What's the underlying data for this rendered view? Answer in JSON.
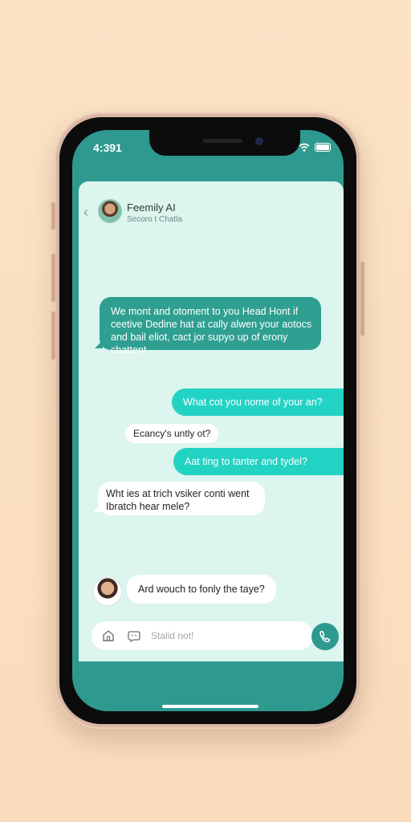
{
  "status_bar": {
    "time": "4:391"
  },
  "chat_header": {
    "back_label": "‹",
    "name": "Feemily AI",
    "subtitle": "Secoro t Chatla"
  },
  "messages": [
    {
      "text": "We mont and otoment to you Head Hont if ceetive Dedine hat at cally alwen your aotocs and bail eliot, cact jor supyo up of erony chattent"
    },
    {
      "text": "What cot you nome of your an?"
    },
    {
      "text": "Ecancy's untly ot?"
    },
    {
      "text": "Aat ting to tanter and tydel?"
    },
    {
      "text": "Wht ies at trich vsiker conti went Ibratch hear mele?"
    },
    {
      "text": "Ard wouch to fonly the taye?"
    }
  ],
  "composer": {
    "placeholder": "Stalid not!"
  },
  "colors": {
    "accent": "#2e9a8f",
    "outgoing": "#22d3c4",
    "chat_bg": "#dcf5ee"
  },
  "icons": {
    "home": "home-icon",
    "emoji": "emoji-icon",
    "call": "phone-icon"
  }
}
